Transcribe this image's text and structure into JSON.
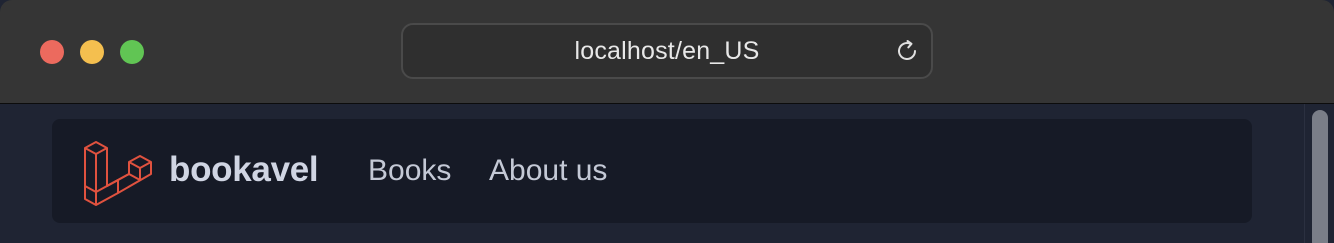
{
  "browser": {
    "url": "localhost/en_US"
  },
  "navbar": {
    "brand": "bookavel",
    "links": [
      {
        "label": "Books"
      },
      {
        "label": "About us"
      }
    ]
  },
  "icons": {
    "logo": "laravel-logo-icon",
    "reload": "reload-icon"
  },
  "colors": {
    "logo": "#e0523f",
    "navbar_bg": "#161a26",
    "page_bg": "#1f2433",
    "titlebar_bg": "#353535"
  }
}
